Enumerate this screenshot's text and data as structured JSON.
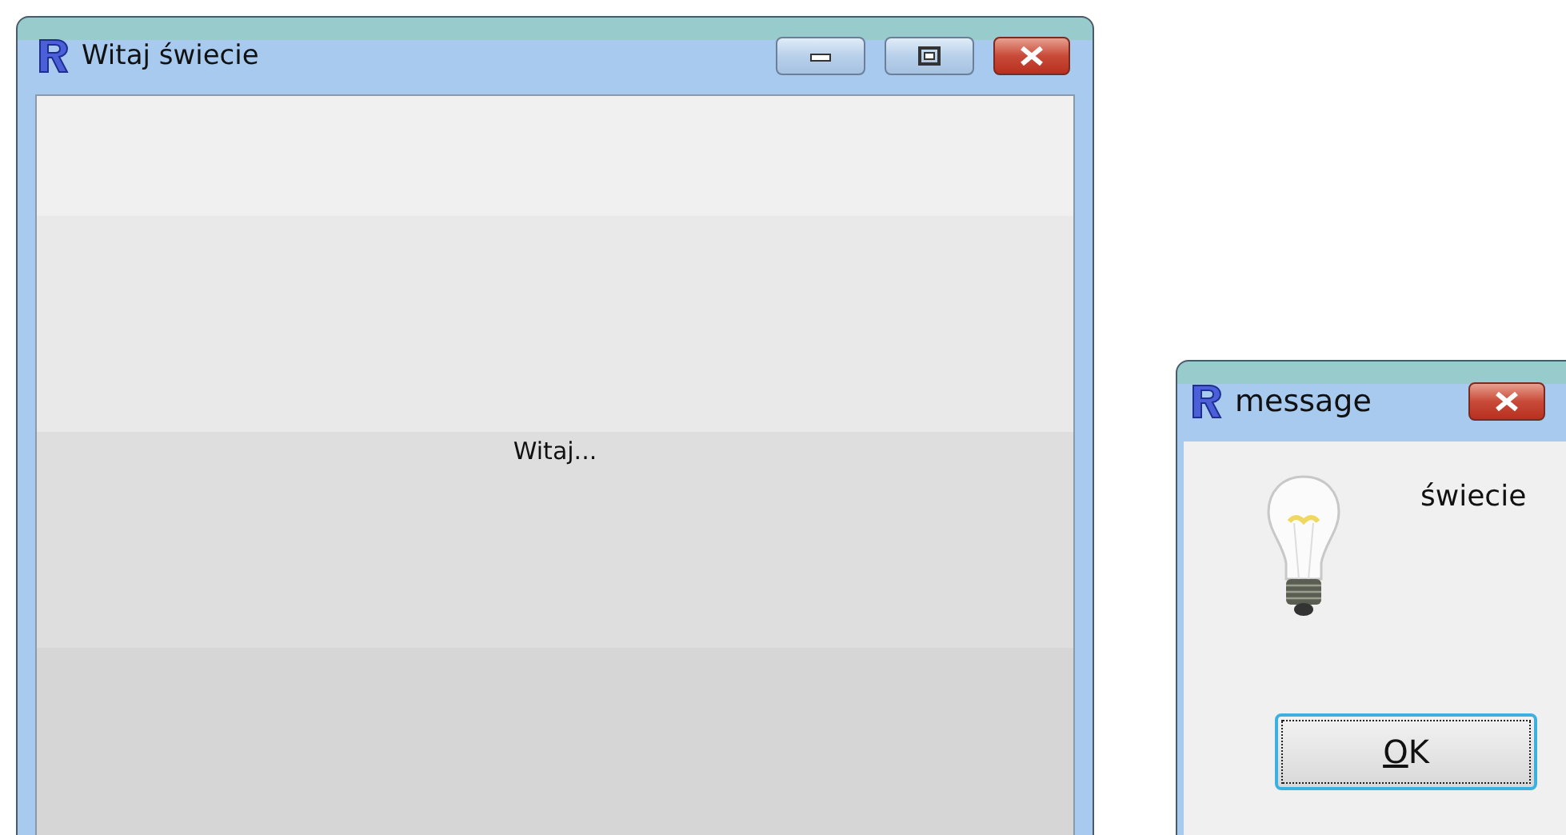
{
  "main_window": {
    "title": "Witaj świecie",
    "label": "Witaj..."
  },
  "message_window": {
    "title": "message",
    "text": "świecie",
    "ok_button": {
      "access_key": "O",
      "label_rest": "K",
      "focused": true
    }
  }
}
